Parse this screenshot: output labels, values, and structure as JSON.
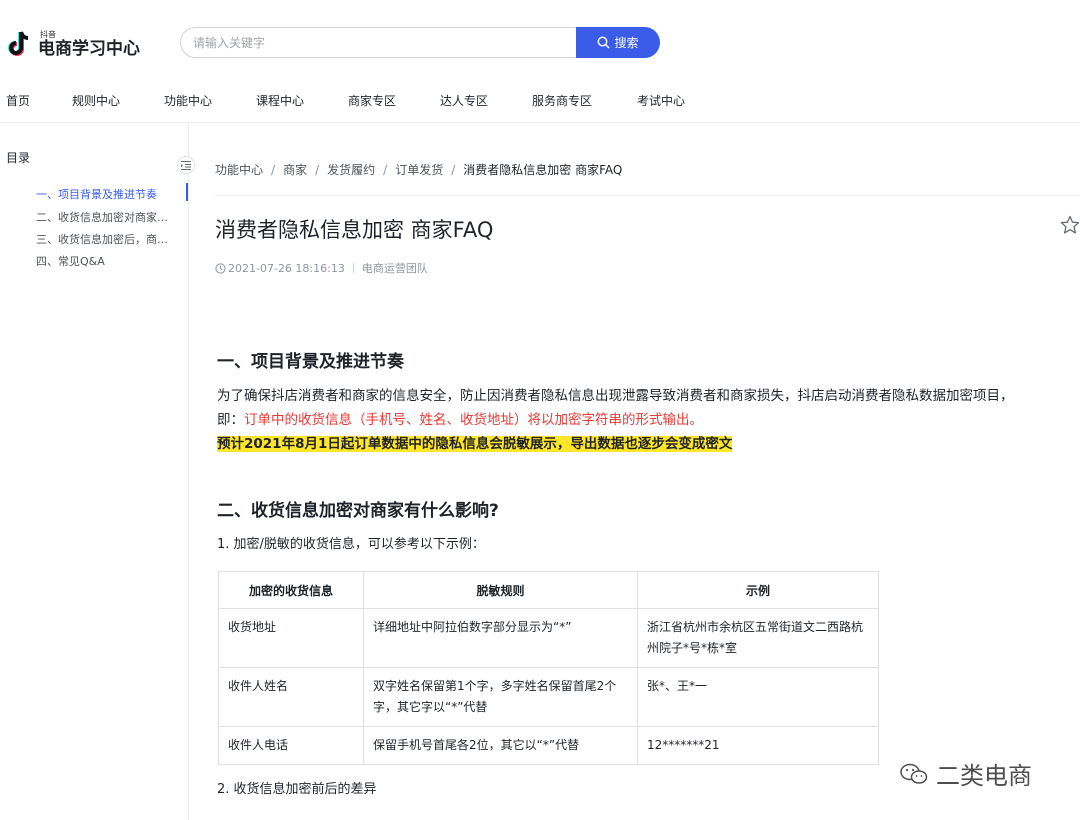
{
  "header": {
    "logo_small": "抖音",
    "logo_big": "电商学习中心",
    "search_placeholder": "请输入关键字",
    "search_button": "搜索",
    "nav": [
      "首页",
      "规则中心",
      "功能中心",
      "课程中心",
      "商家专区",
      "达人专区",
      "服务商专区",
      "考试中心"
    ]
  },
  "sidebar": {
    "title": "目录",
    "items": [
      "一、项目背景及推进节奏",
      "二、收货信息加密对商家有什么影响？",
      "三、收货信息加密后，商家需要做什么？",
      "四、常见Q&A"
    ]
  },
  "breadcrumb": [
    "功能中心",
    "商家",
    "发货履约",
    "订单发货",
    "消费者隐私信息加密 商家FAQ"
  ],
  "article": {
    "title": "消费者隐私信息加密 商家FAQ",
    "date": "2021-07-26 18:16:13",
    "author": "电商运营团队",
    "section1_heading": "一、项目背景及推进节奏",
    "section1_p1": "为了确保抖店消费者和商家的信息安全，防止因消费者隐私信息出现泄露导致消费者和商家损失，抖店启动消费者隐私数据加密项目，",
    "section1_p2_prefix": "即：",
    "section1_p2_red": "订单中的收货信息（手机号、姓名、收货地址）将以加密字符串的形式输出。",
    "section1_highlight": "预计2021年8月1日起订单数据中的隐私信息会脱敏展示，导出数据也逐步会变成密文",
    "section2_heading": "二、收货信息加密对商家有什么影响?",
    "section2_item1": "1. 加密/脱敏的收货信息，可以参考以下示例：",
    "section2_item2": "2. 收货信息加密前后的差异"
  },
  "table": {
    "headers": [
      "加密的收货信息",
      "脱敏规则",
      "示例"
    ],
    "rows": [
      [
        "收货地址",
        "详细地址中阿拉伯数字部分显示为“*”",
        "浙江省杭州市余杭区五常街道文二西路杭州院子*号*栋*室"
      ],
      [
        "收件人姓名",
        "双字姓名保留第1个字，多字姓名保留首尾2个字，其它字以“*”代替",
        "张*、王*一"
      ],
      [
        "收件人电话",
        "保留手机号首尾各2位，其它以“*”代替",
        "12*******21"
      ]
    ]
  },
  "watermark": "二类电商",
  "colors": {
    "accent": "#3a5ce8",
    "red": "#e53935",
    "highlight": "#ffe628"
  }
}
